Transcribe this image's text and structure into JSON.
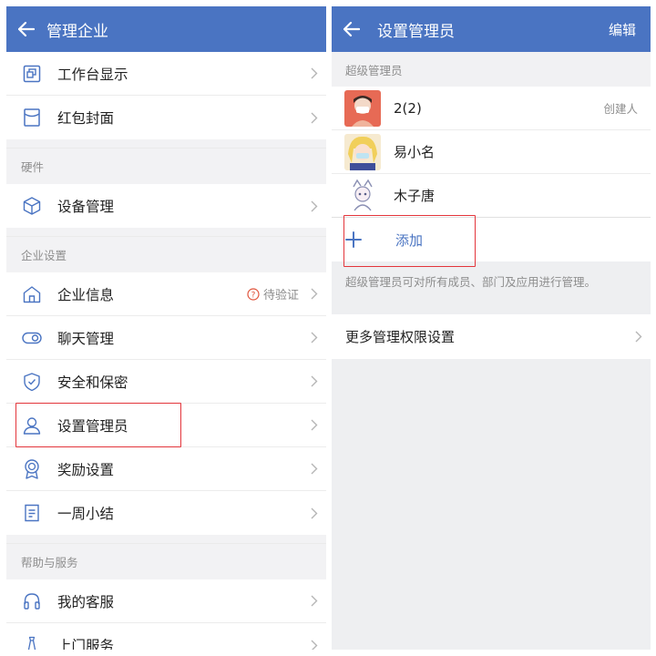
{
  "left": {
    "title": "管理企业",
    "top_items": [
      {
        "label": "工作台显示"
      },
      {
        "label": "红包封面"
      }
    ],
    "hardware": {
      "header": "硬件",
      "items": [
        {
          "label": "设备管理"
        }
      ]
    },
    "enterprise": {
      "header": "企业设置",
      "items": [
        {
          "label": "企业信息",
          "extra": "待验证"
        },
        {
          "label": "聊天管理"
        },
        {
          "label": "安全和保密"
        },
        {
          "label": "设置管理员"
        },
        {
          "label": "奖励设置"
        },
        {
          "label": "一周小结"
        }
      ]
    },
    "help": {
      "header": "帮助与服务",
      "items": [
        {
          "label": "我的客服"
        },
        {
          "label": "上门服务"
        }
      ]
    }
  },
  "right": {
    "title": "设置管理员",
    "edit_label": "编辑",
    "section_header": "超级管理员",
    "members": [
      {
        "name": "2(2)",
        "tag": "创建人"
      },
      {
        "name": "易小名"
      },
      {
        "name": "木子唐"
      }
    ],
    "add_label": "添加",
    "note": "超级管理员可对所有成员、部门及应用进行管理。",
    "more_label": "更多管理权限设置"
  },
  "colors": {
    "header_bg": "#4a74c2",
    "accent": "#4a74c2",
    "highlight": "#e3353b"
  }
}
